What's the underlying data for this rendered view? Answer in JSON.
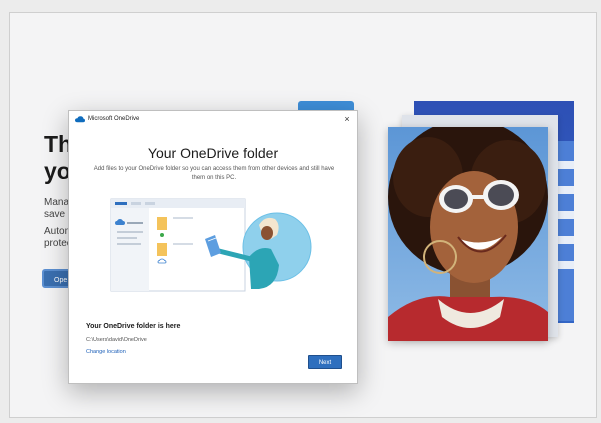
{
  "background": {
    "heading_line1": "The",
    "heading_line2": "you",
    "para1_line1": "Manag",
    "para1_line2": "save in",
    "para2_line1": "Autom",
    "para2_line2": "protec",
    "button_label": "Ope"
  },
  "dialog": {
    "app_title": "Microsoft OneDrive",
    "close_glyph": "×",
    "heading": "Your OneDrive folder",
    "description": "Add files to your OneDrive folder so you can access them from other devices and still have them on this PC.",
    "location_label": "Your OneDrive folder is here",
    "location_path": "C:\\Users\\david\\OneDrive",
    "change_location": "Change location",
    "next_label": "Next"
  },
  "colors": {
    "accent": "#2e6fbe",
    "link": "#1c5fb8",
    "onedrive_blue": "#0f6cbd"
  },
  "icons": [
    "onedrive-cloud-icon",
    "close-icon",
    "folder-icon"
  ]
}
